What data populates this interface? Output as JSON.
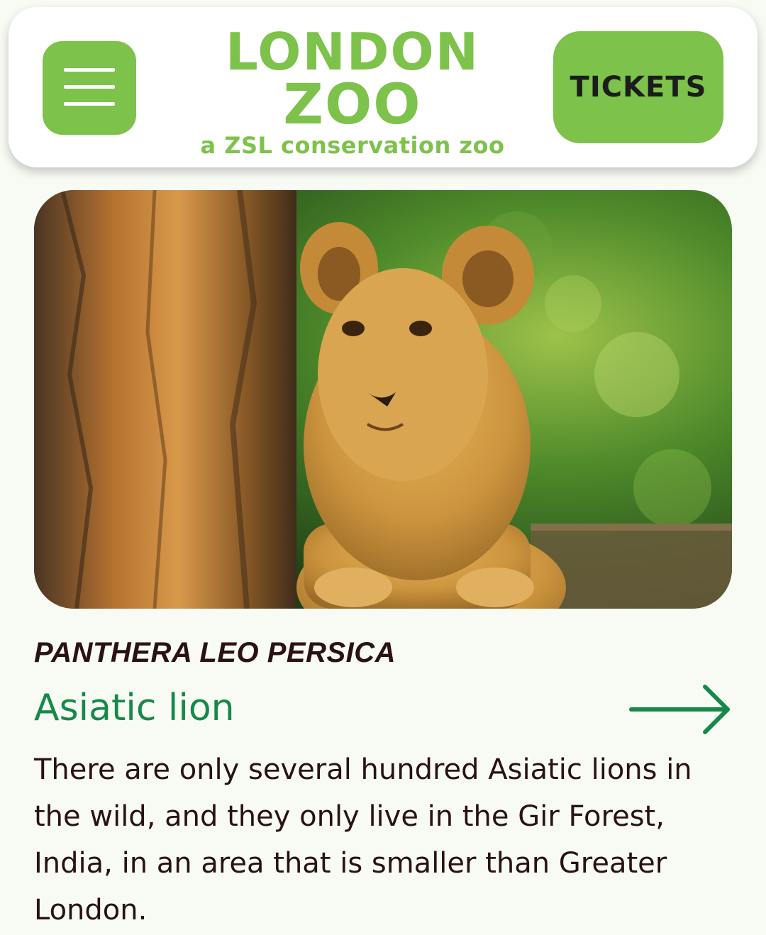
{
  "header": {
    "logo": {
      "line1": "LONDON",
      "line2": "ZOO",
      "tagline": "a ZSL conservation zoo"
    },
    "tickets_label": "TICKETS",
    "brand_color": "#7dc24a"
  },
  "icons": {
    "menu": "hamburger-menu-icon",
    "arrow": "arrow-right-icon"
  },
  "animal": {
    "scientific_name": "PANTHERA LEO PERSICA",
    "common_name": "Asiatic lion",
    "description": "There are only several hundred Asiatic lions in the wild, and they only live in the Gir Forest, India, in an area that is smaller than Greater London."
  },
  "colors": {
    "accent_green": "#16894a",
    "text_dark": "#2a1212",
    "page_background": "#f8fbf3"
  }
}
